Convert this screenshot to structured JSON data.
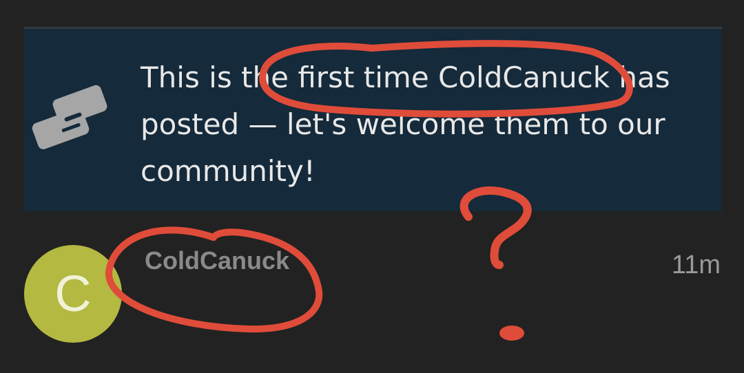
{
  "notice": {
    "text": "This is the first time ColdCanuck has posted — let's welcome them to our community!",
    "icon": "handshake-icon"
  },
  "post": {
    "avatar_letter": "C",
    "username": "ColdCanuck",
    "timestamp": "11m"
  },
  "colors": {
    "background": "#222222",
    "notice_background": "#152a3a",
    "avatar": "#b3b941",
    "annotation": "#e04c3a"
  }
}
